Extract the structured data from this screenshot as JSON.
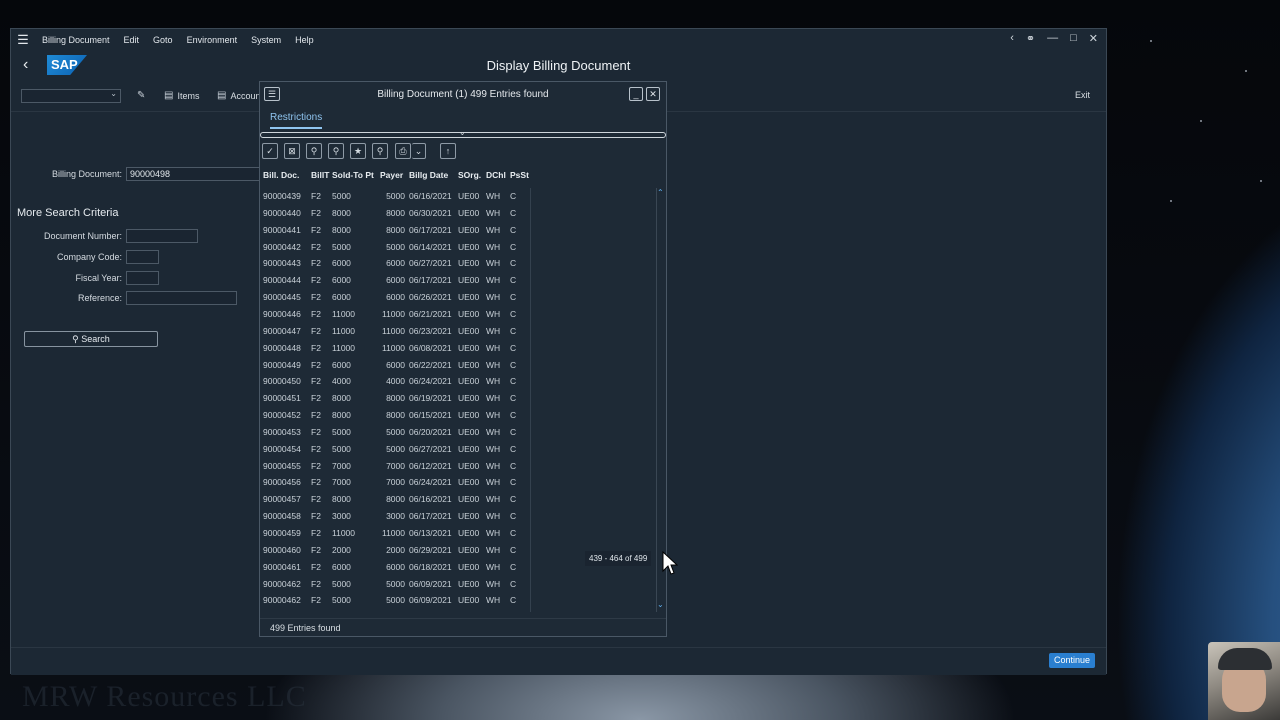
{
  "menubar": {
    "items": [
      "Billing Document",
      "Edit",
      "Goto",
      "Environment",
      "System",
      "Help"
    ]
  },
  "window": {
    "title": "Display Billing Document",
    "logo_text": "SAP"
  },
  "toolbar": {
    "items_label": "Items",
    "accounting_label": "Accoun",
    "exit_label": "Exit"
  },
  "form": {
    "billing_document_label": "Billing Document:",
    "billing_document_value": "90000498",
    "more_criteria_title": "More Search Criteria",
    "document_number_label": "Document Number:",
    "company_code_label": "Company Code:",
    "fiscal_year_label": "Fiscal Year:",
    "reference_label": "Reference:",
    "search_label": "Search"
  },
  "footer": {
    "continue_label": "Continue"
  },
  "dialog": {
    "title": "Billing Document (1)  499 Entries found",
    "tab_label": "Restrictions",
    "columns": [
      "Bill. Doc.",
      "BillT",
      "Sold-To Pt",
      "Payer",
      "Billg Date",
      "SOrg.",
      "DChl",
      "PsSt"
    ],
    "rows": [
      [
        "90000439",
        "F2",
        "5000",
        "5000",
        "06/16/2021",
        "UE00",
        "WH",
        "C"
      ],
      [
        "90000440",
        "F2",
        "8000",
        "8000",
        "06/30/2021",
        "UE00",
        "WH",
        "C"
      ],
      [
        "90000441",
        "F2",
        "8000",
        "8000",
        "06/17/2021",
        "UE00",
        "WH",
        "C"
      ],
      [
        "90000442",
        "F2",
        "5000",
        "5000",
        "06/14/2021",
        "UE00",
        "WH",
        "C"
      ],
      [
        "90000443",
        "F2",
        "6000",
        "6000",
        "06/27/2021",
        "UE00",
        "WH",
        "C"
      ],
      [
        "90000444",
        "F2",
        "6000",
        "6000",
        "06/17/2021",
        "UE00",
        "WH",
        "C"
      ],
      [
        "90000445",
        "F2",
        "6000",
        "6000",
        "06/26/2021",
        "UE00",
        "WH",
        "C"
      ],
      [
        "90000446",
        "F2",
        "11000",
        "11000",
        "06/21/2021",
        "UE00",
        "WH",
        "C"
      ],
      [
        "90000447",
        "F2",
        "11000",
        "11000",
        "06/23/2021",
        "UE00",
        "WH",
        "C"
      ],
      [
        "90000448",
        "F2",
        "11000",
        "11000",
        "06/08/2021",
        "UE00",
        "WH",
        "C"
      ],
      [
        "90000449",
        "F2",
        "6000",
        "6000",
        "06/22/2021",
        "UE00",
        "WH",
        "C"
      ],
      [
        "90000450",
        "F2",
        "4000",
        "4000",
        "06/24/2021",
        "UE00",
        "WH",
        "C"
      ],
      [
        "90000451",
        "F2",
        "8000",
        "8000",
        "06/19/2021",
        "UE00",
        "WH",
        "C"
      ],
      [
        "90000452",
        "F2",
        "8000",
        "8000",
        "06/15/2021",
        "UE00",
        "WH",
        "C"
      ],
      [
        "90000453",
        "F2",
        "5000",
        "5000",
        "06/20/2021",
        "UE00",
        "WH",
        "C"
      ],
      [
        "90000454",
        "F2",
        "5000",
        "5000",
        "06/27/2021",
        "UE00",
        "WH",
        "C"
      ],
      [
        "90000455",
        "F2",
        "7000",
        "7000",
        "06/12/2021",
        "UE00",
        "WH",
        "C"
      ],
      [
        "90000456",
        "F2",
        "7000",
        "7000",
        "06/24/2021",
        "UE00",
        "WH",
        "C"
      ],
      [
        "90000457",
        "F2",
        "8000",
        "8000",
        "06/16/2021",
        "UE00",
        "WH",
        "C"
      ],
      [
        "90000458",
        "F2",
        "3000",
        "3000",
        "06/17/2021",
        "UE00",
        "WH",
        "C"
      ],
      [
        "90000459",
        "F2",
        "11000",
        "11000",
        "06/13/2021",
        "UE00",
        "WH",
        "C"
      ],
      [
        "90000460",
        "F2",
        "2000",
        "2000",
        "06/29/2021",
        "UE00",
        "WH",
        "C"
      ],
      [
        "90000461",
        "F2",
        "6000",
        "6000",
        "06/18/2021",
        "UE00",
        "WH",
        "C"
      ],
      [
        "90000462",
        "F2",
        "5000",
        "5000",
        "06/09/2021",
        "UE00",
        "WH",
        "C"
      ],
      [
        "90000462",
        "F2",
        "5000",
        "5000",
        "06/09/2021",
        "UE00",
        "WH",
        "C"
      ]
    ],
    "status": "499 Entries found",
    "scroll_tooltip": "439 - 464 of 499"
  },
  "colors": {
    "accent": "#2a7fd0",
    "link": "#8fc4ef",
    "window_bg": "#1c2834"
  },
  "overlay": {
    "watermark": "MRW Resources LLC"
  }
}
